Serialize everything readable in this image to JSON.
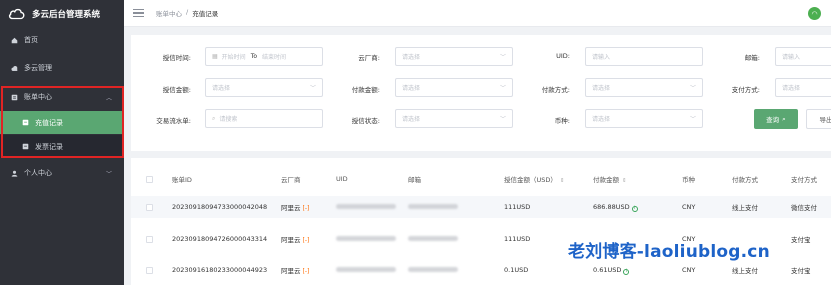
{
  "app": {
    "title": "多云后台管理系统"
  },
  "sidebar": {
    "items": [
      {
        "label": "首页",
        "icon": "home-icon"
      },
      {
        "label": "多云管理",
        "icon": "cloud-icon"
      },
      {
        "label": "账单中心",
        "icon": "bill-icon",
        "expanded": true,
        "children": [
          {
            "label": "充值记录",
            "active": true
          },
          {
            "label": "发票记录",
            "active": false
          }
        ]
      },
      {
        "label": "个人中心",
        "icon": "user-icon"
      }
    ]
  },
  "header": {
    "breadcrumb": [
      "账单中心",
      "/",
      "充值记录"
    ]
  },
  "filters": {
    "row1": {
      "time_label": "授信时间:",
      "start_placeholder": "开始时间",
      "to": "To",
      "end_placeholder": "结束时间",
      "vendor_label": "云厂商:",
      "vendor_placeholder": "请选择",
      "uid_label": "UID:",
      "uid_placeholder": "请输入",
      "email_label": "邮箱:",
      "email_placeholder": "请输入"
    },
    "row2": {
      "credit_amount_label": "授信金额:",
      "credit_amount_placeholder": "请选择",
      "pay_amount_label": "付款金额:",
      "pay_amount_placeholder": "请选择",
      "pay_method_label": "付款方式:",
      "pay_method_placeholder": "请选择",
      "payment_method_label": "支付方式:",
      "payment_method_placeholder": "请选择"
    },
    "row3": {
      "serial_label": "交易流水单:",
      "serial_placeholder": "请搜索",
      "status_label": "授信状态:",
      "status_placeholder": "请选择",
      "currency_label": "币种:",
      "currency_placeholder": "请选择"
    },
    "query_button": "查询",
    "export_button": "导出"
  },
  "table": {
    "columns": [
      "账单ID",
      "云厂商",
      "UID",
      "邮箱",
      "授信金额（USD）",
      "付款金额",
      "币种",
      "付款方式",
      "支付方式"
    ],
    "rows": [
      {
        "id": "20230918094733000042048",
        "vendor": "阿里云",
        "credit": "111USD",
        "payment": "686.88USD",
        "currency": "CNY",
        "pay_method": "线上支付",
        "payment_method": "微信支付"
      },
      {
        "id": "20230918094726000043314",
        "vendor": "阿里云",
        "credit": "111USD",
        "payment": "",
        "currency": "CNY",
        "pay_method": "",
        "payment_method": "支付宝"
      },
      {
        "id": "20230916180233000044923",
        "vendor": "阿里云",
        "credit": "0.1USD",
        "payment": "0.61USD",
        "currency": "CNY",
        "pay_method": "线上支付",
        "payment_method": "支付宝"
      }
    ]
  },
  "watermark": "老刘博客-laoliublog.cn",
  "colors": {
    "sidebar_bg": "#2f3138",
    "accent": "#5aa772",
    "highlight_box": "#e02424"
  }
}
